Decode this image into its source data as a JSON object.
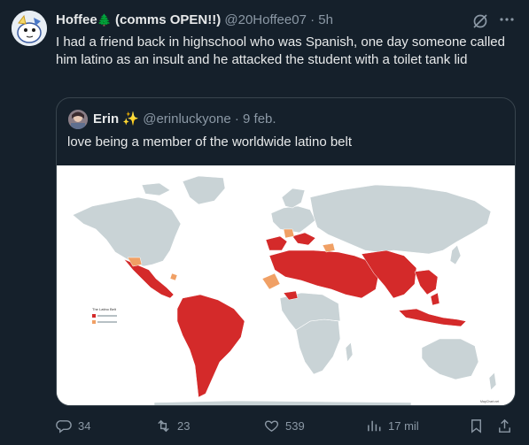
{
  "tweet": {
    "author_name": "Hoffee",
    "author_emoji": "🌲",
    "author_suffix": "(comms OPEN!!)",
    "handle": "@20Hoffee07",
    "separator": "·",
    "time": "5h",
    "text": "I had a friend back in highschool who was Spanish, one day someone called him latino as an insult and he attacked the student with a toilet tank lid"
  },
  "quote": {
    "author_name": "Erin",
    "author_emoji": "✨",
    "handle": "@erinluckyone",
    "separator": "·",
    "time": "9 feb.",
    "text": "love being a member of the worldwide latino belt"
  },
  "map": {
    "legend_title": "The Latino Belt",
    "credit": "MapChart.net",
    "colors": {
      "ocean": "#ffffff",
      "land": "#c9d3d6",
      "primary": "#d42a2a",
      "secondary": "#f0a065"
    }
  },
  "actions": {
    "replies": "34",
    "reposts": "23",
    "likes": "539",
    "views": "17 mil"
  }
}
